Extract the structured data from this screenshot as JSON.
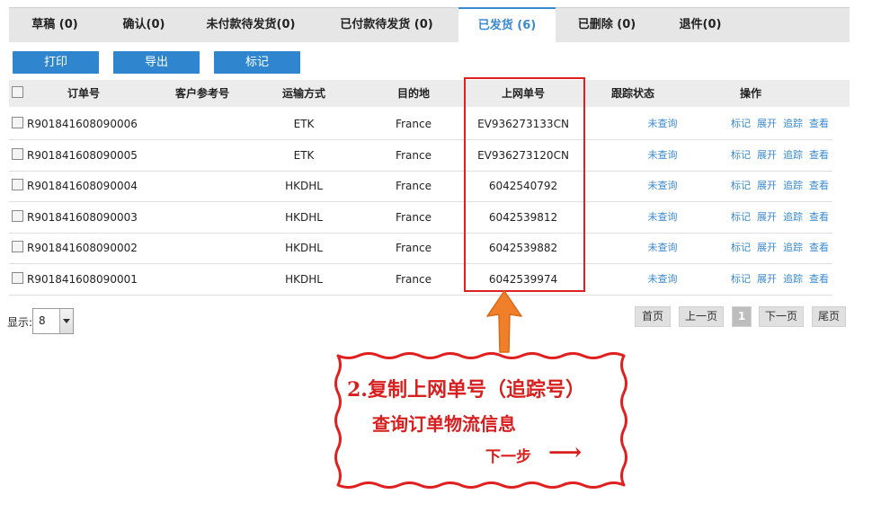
{
  "tabs": [
    {
      "label": "草稿 (0)"
    },
    {
      "label": "确认(0)"
    },
    {
      "label": "未付款待发货(0)"
    },
    {
      "label": "已付款待发货 (0)"
    },
    {
      "label": "已发货 (6)"
    },
    {
      "label": "已删除 (0)"
    },
    {
      "label": "退件(0)"
    }
  ],
  "active_tab": 4,
  "toolbar": {
    "print_label": "打印",
    "export_label": "导出",
    "mark_label": "标记"
  },
  "table": {
    "headers": {
      "order_no": "订单号",
      "customer_ref": "客户参考号",
      "shipping": "运输方式",
      "destination": "目的地",
      "tracking_no": "上网单号",
      "track_status": "跟踪状态",
      "actions": "操作"
    },
    "rows": [
      {
        "order_no": "R901841608090006",
        "customer_ref": "",
        "shipping": "ETK",
        "destination": "France",
        "tracking_no": "EV936273133CN",
        "status": "未查询"
      },
      {
        "order_no": "R901841608090005",
        "customer_ref": "",
        "shipping": "ETK",
        "destination": "France",
        "tracking_no": "EV936273120CN",
        "status": "未查询"
      },
      {
        "order_no": "R901841608090004",
        "customer_ref": "",
        "shipping": "HKDHL",
        "destination": "France",
        "tracking_no": "6042540792",
        "status": "未查询"
      },
      {
        "order_no": "R901841608090003",
        "customer_ref": "",
        "shipping": "HKDHL",
        "destination": "France",
        "tracking_no": "6042539812",
        "status": "未查询"
      },
      {
        "order_no": "R901841608090002",
        "customer_ref": "",
        "shipping": "HKDHL",
        "destination": "France",
        "tracking_no": "6042539882",
        "status": "未查询"
      },
      {
        "order_no": "R901841608090001",
        "customer_ref": "",
        "shipping": "HKDHL",
        "destination": "France",
        "tracking_no": "6042539974",
        "status": "未查询"
      }
    ],
    "row_actions": [
      "标记",
      "展开",
      "追踪",
      "查看"
    ]
  },
  "page_size": {
    "label": "显示:",
    "value": "8"
  },
  "pagination": {
    "first": "首页",
    "prev": "上一页",
    "current": "1",
    "next": "下一页",
    "last": "尾页"
  },
  "annotation": {
    "line1": "2.复制上网单号（追踪号）",
    "line2": "查询订单物流信息",
    "line3": "下一步",
    "arrow_glyph": "⟶"
  },
  "colors": {
    "accent": "#2f86cf",
    "link": "#3b8ad0",
    "highlight": "#e02020",
    "arrow": "#f07f2a"
  },
  "icons": {
    "checkbox": "checkbox-icon",
    "dropdown": "chevron-down-icon",
    "arrow": "arrow-up-icon"
  }
}
